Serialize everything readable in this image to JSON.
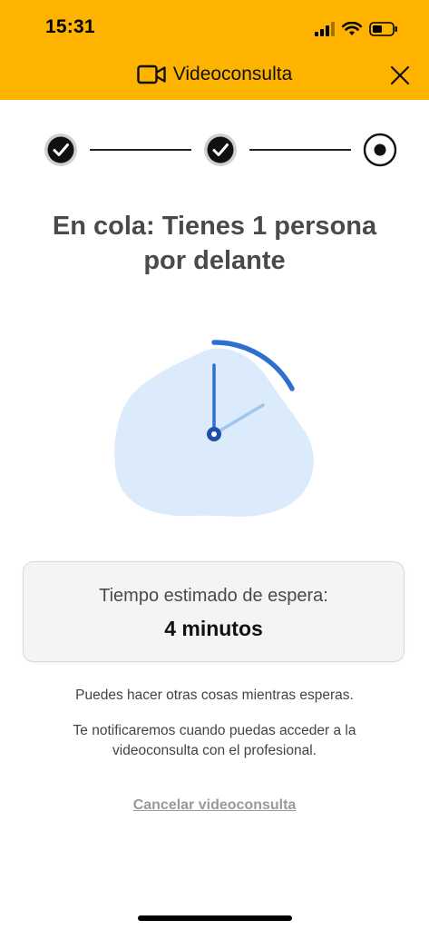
{
  "status_bar": {
    "time": "15:31"
  },
  "header": {
    "title": "Videoconsulta",
    "icon": "video-camera-icon",
    "close_icon": "close-icon",
    "background": "#FDB300"
  },
  "steps": [
    {
      "state": "completed",
      "icon": "checkmark-icon"
    },
    {
      "state": "completed",
      "icon": "checkmark-icon"
    },
    {
      "state": "current",
      "icon": "radio-dot-icon"
    }
  ],
  "main": {
    "heading_line1": "En cola: Tienes 1 persona",
    "heading_line2": "por delante",
    "illustration": "clock-waiting-icon",
    "wait_card": {
      "label": "Tiempo estimado de espera:",
      "value": "4 minutos"
    },
    "info_line1": "Puedes hacer otras cosas mientras esperas.",
    "info_line2a": "Te notificaremos cuando puedas acceder a la",
    "info_line2b": "videoconsulta con el profesional.",
    "cancel_link": "Cancelar videoconsulta"
  },
  "colors": {
    "accent_blue": "#2F6FD0",
    "blob": "#DCEBFB",
    "heading": "#4a4a4a"
  }
}
